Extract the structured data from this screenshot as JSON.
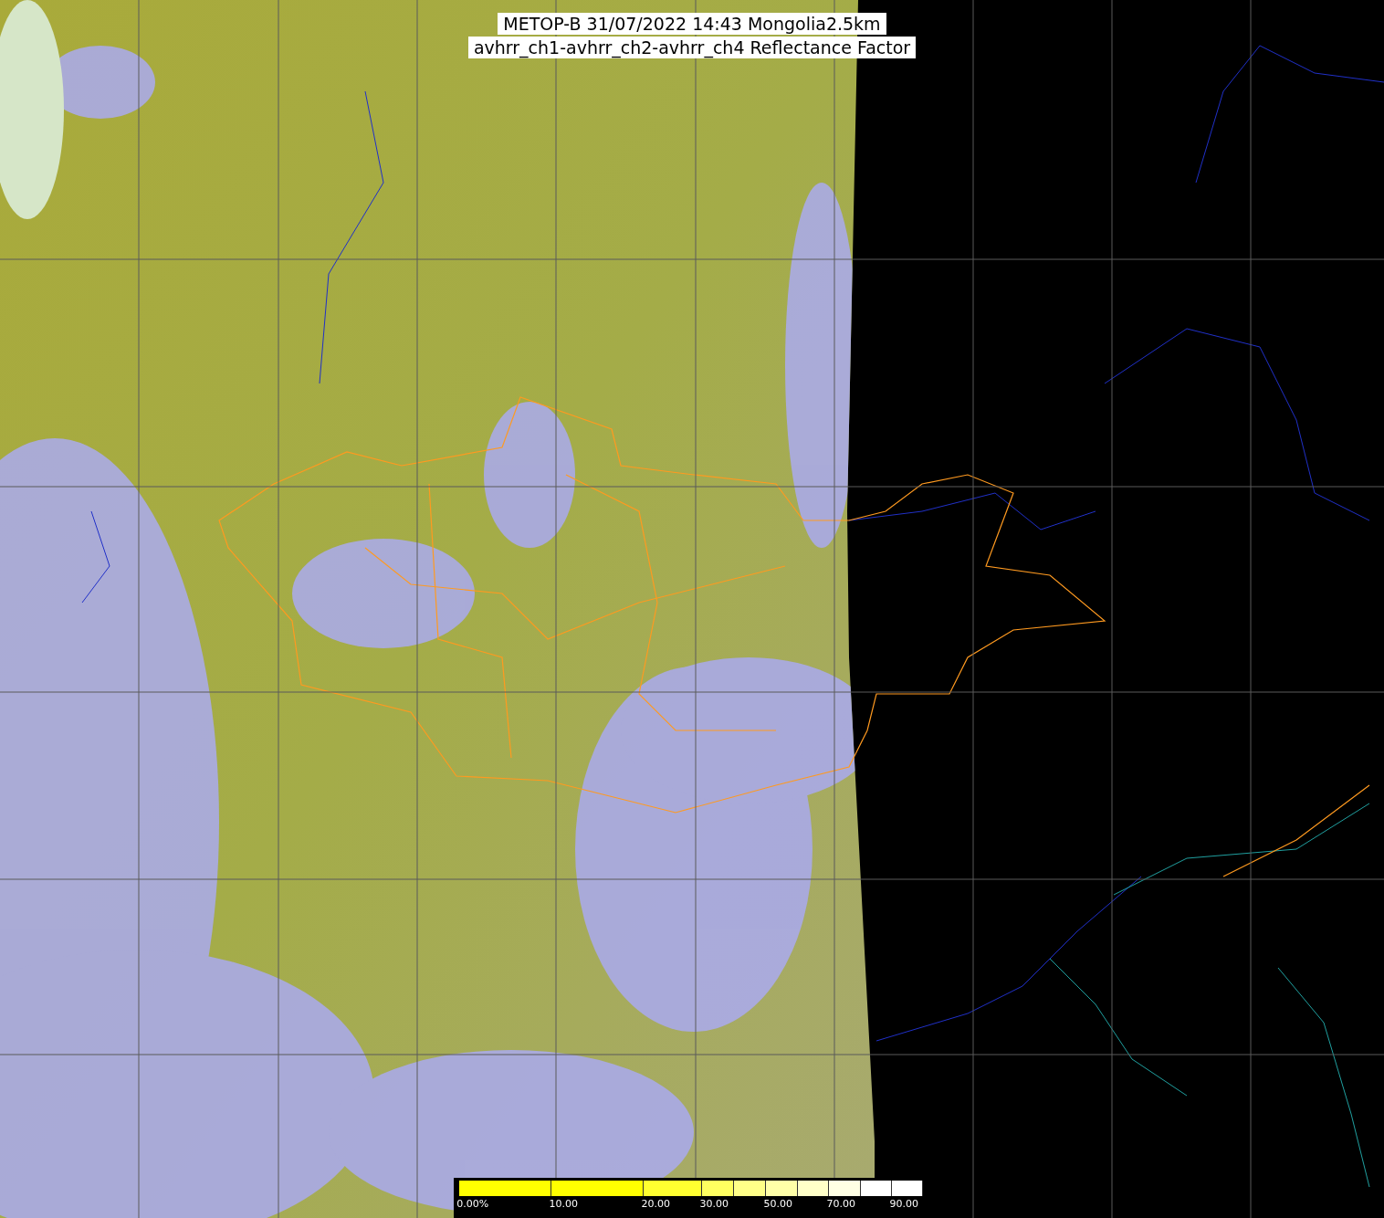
{
  "title": {
    "lines": [
      "METOP-B 31/07/2022 14:43 Mongolia2.5km",
      "avhrr_ch1-avhrr_ch2-avhrr_ch4 Reflectance Factor"
    ]
  },
  "colorbar": {
    "labels": [
      "0.00%",
      "10.00",
      "20.00",
      "30.00",
      "50.00",
      "70.00",
      "90.00"
    ]
  }
}
